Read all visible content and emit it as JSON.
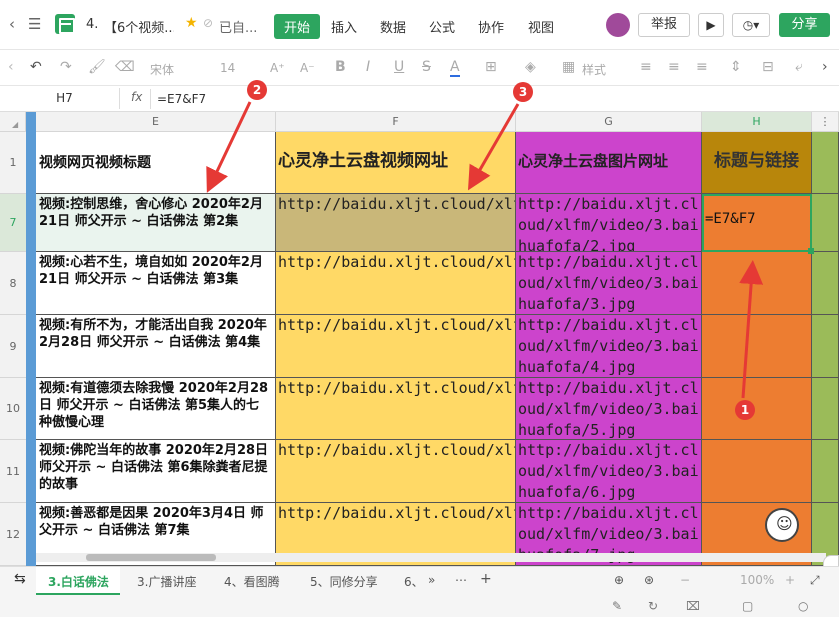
{
  "titlebar": {
    "doc_num": "4.",
    "doc_title": "【6个视频...",
    "status": "已自...",
    "menus": [
      "开始",
      "插入",
      "数据",
      "公式",
      "协作",
      "视图"
    ],
    "report_label": "举报",
    "share_label": "分享"
  },
  "toolbar": {
    "font": "宋体",
    "size": "14",
    "grow": "A⁺",
    "shrink": "A⁻",
    "bold": "B",
    "italic": "I",
    "underline": "U",
    "strike": "S",
    "fontcolor": "A",
    "style": "样式"
  },
  "formula": {
    "cell_ref": "H7",
    "fx": "fx",
    "content": "=E7&F7"
  },
  "columns": [
    "E",
    "F",
    "G",
    "H"
  ],
  "header_row": {
    "num": "1",
    "e": "视频网页视频标题",
    "f": "心灵净土云盘视频网址",
    "g": "心灵净土云盘图片网址",
    "h": "标题与链接"
  },
  "rows": [
    {
      "num": "7",
      "e": "视频:控制思维，舍心修心 2020年2月21日 师父开示 ~ 白话佛法 第2集",
      "f": "http://baidu.xljt.cloud/xlfm/video/3.baihuafofa/2.mp4",
      "g": "http://baidu.xljt.cloud/xlfm/video/3.baihuafofa/2.jpg",
      "h": "=E7&F7"
    },
    {
      "num": "8",
      "e": "视频:心若不生，境自如如 2020年2月21日 师父开示 ~ 白话佛法 第3集",
      "f": "http://baidu.xljt.cloud/xlfm/video/3.baihuafofa/3.mp4",
      "g": "http://baidu.xljt.cloud/xlfm/video/3.baihuafofa/3.jpg",
      "h": ""
    },
    {
      "num": "9",
      "e": "视频:有所不为，才能活出自我 2020年2月28日 师父开示 ~ 白话佛法 第4集",
      "f": "http://baidu.xljt.cloud/xlfm/video/3.baihuafofa/4.mp4",
      "g": "http://baidu.xljt.cloud/xlfm/video/3.baihuafofa/4.jpg",
      "h": ""
    },
    {
      "num": "10",
      "e": "视频:有道德须去除我慢 2020年2月28日 师父开示 ~ 白话佛法 第5集人的七种傲慢心理",
      "f": "http://baidu.xljt.cloud/xlfm/video/3.baihuafofa/5.mp4",
      "g": "http://baidu.xljt.cloud/xlfm/video/3.baihuafofa/5.jpg",
      "h": ""
    },
    {
      "num": "11",
      "e": "视频:佛陀当年的故事 2020年2月28日 师父开示 ~ 白话佛法 第6集除粪者尼提的故事",
      "f": "http://baidu.xljt.cloud/xlfm/video/3.baihuafofa/6.mp4",
      "g": "http://baidu.xljt.cloud/xlfm/video/3.baihuafofa/6.jpg",
      "h": ""
    },
    {
      "num": "12",
      "e": "视频:善恶都是因果 2020年3月4日 师父开示 ~ 白话佛法 第7集",
      "f": "http://baidu.xljt.cloud/xlfm/video/3.baihuafofa/7.mp4",
      "g": "http://baidu.xljt.cloud/xlfm/video/3.baihuafofa/7.jpg",
      "h": ""
    }
  ],
  "tabs": [
    "3.白话佛法",
    "3.广播讲座",
    "4、看图腾",
    "5、同修分享",
    "6、"
  ],
  "zoom": "100%",
  "markers": [
    "1",
    "2",
    "3"
  ],
  "colors": {
    "accent": "#2da55f",
    "yellow": "#ffd966",
    "magenta": "#cc44cc",
    "orange": "#ed7d31",
    "green": "#9bbb59",
    "marker": "#e53935"
  }
}
